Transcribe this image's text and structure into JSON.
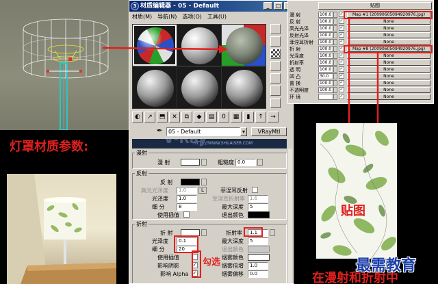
{
  "editor": {
    "title": "材质编辑器 - 05 - Default",
    "menu": [
      "材质(M)",
      "导航(N)",
      "选项(O)",
      "工具(U)"
    ],
    "material_name": "05 - Default",
    "material_type": "VRayMtl",
    "banner_text": "HTTP://WWW.SHUAISER.COM"
  },
  "diffuse": {
    "rollout_title": "漫射",
    "diffuse_label": "漫  射",
    "roughness_label": "粗糙度",
    "roughness_value": "0.0"
  },
  "reflect": {
    "rollout_title": "反射",
    "reflect_label": "反  射",
    "hilight_label": "高光光泽度",
    "hilight_value": "1.0",
    "fresnel_label": "菲涅耳反射",
    "gloss_label": "光泽度",
    "gloss_value": "1.0",
    "fresnel_ior_label": "菲涅耳折射率",
    "fresnel_ior_value": "1.6",
    "subdivs_label": "细  分",
    "subdivs_value": "8",
    "max_depth_label": "最大深度",
    "max_depth_value": "5",
    "interp_label": "使用插值",
    "exit_label": "退出颜色",
    "lock_label": "L"
  },
  "refract": {
    "rollout_title": "折射",
    "refract_label": "折  射",
    "ior_label": "折射率",
    "ior_value": "1.1",
    "gloss_label": "光泽度",
    "gloss_value": "0.1",
    "max_depth_label": "最大深度",
    "max_depth_value": "5",
    "subdivs_label": "细  分",
    "subdivs_value": "20",
    "exit_label": "退出颜色",
    "interp_label": "使用插值",
    "affect_shadows_label": "影响阴影",
    "fog_color_label": "烟雾颜色",
    "fog_mult_label": "烟雾倍增",
    "fog_mult_value": "1.0",
    "fog_bias_label": "烟雾偏移",
    "fog_bias_value": "0.0",
    "affect_alpha_label": "影响 Alpha"
  },
  "maps": {
    "header": "贴图",
    "rows": [
      {
        "name": "漫  射",
        "amount": "100.0",
        "map": "Map #1 (20090605094920976.jpg)"
      },
      {
        "name": "反  射",
        "amount": "100.0",
        "map": "None"
      },
      {
        "name": "高光光泽",
        "amount": "100.0",
        "map": "None"
      },
      {
        "name": "反射光泽",
        "amount": "100.0",
        "map": "None"
      },
      {
        "name": "菲涅耳折射",
        "amount": "100.0",
        "map": "None"
      },
      {
        "name": "折  射",
        "amount": "100.0",
        "map": "Map #8 (20090605094920976.jpg)"
      },
      {
        "name": "光泽度",
        "amount": "100.0",
        "map": "None"
      },
      {
        "name": "折射率",
        "amount": "100.0",
        "map": "None"
      },
      {
        "name": "透  明",
        "amount": "100.0",
        "map": "None"
      },
      {
        "name": "凹  凸",
        "amount": "30.0",
        "map": "None"
      },
      {
        "name": "置  换",
        "amount": "100.0",
        "map": "None"
      },
      {
        "name": "不透明度",
        "amount": "100.0",
        "map": "None"
      },
      {
        "name": "环  境",
        "amount": "",
        "map": "None"
      }
    ]
  },
  "annotations": {
    "title": "灯罩材质参数:",
    "map_label": "贴图",
    "check_label": "勾选",
    "bottom_note": "在漫射和折射中",
    "watermark": "最需教育"
  },
  "colors": {
    "annotation_red": "#e0201e",
    "panel_grey": "#d4d0c8",
    "titlebar_blue": "#0a246a"
  }
}
